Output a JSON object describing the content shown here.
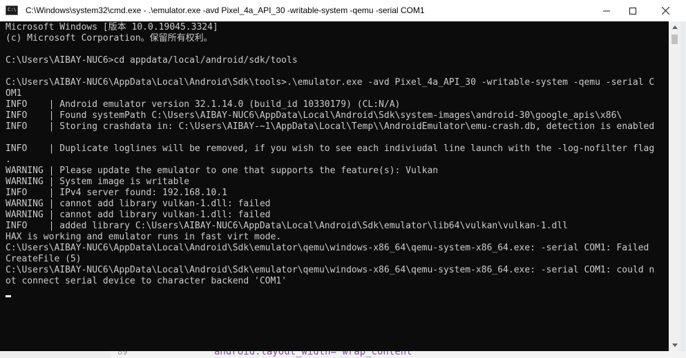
{
  "window": {
    "title": "C:\\Windows\\system32\\cmd.exe - .\\emulator.exe  -avd Pixel_4a_API_30 -writable-system -qemu -serial COM1",
    "icon_label": "C:\\"
  },
  "console": {
    "text": "Microsoft Windows [版本 10.0.19045.3324]\n(c) Microsoft Corporation。保留所有权利。\n\nC:\\Users\\AIBAY-NUC6>cd appdata/local/android/sdk/tools\n\nC:\\Users\\AIBAY-NUC6\\AppData\\Local\\Android\\Sdk\\tools>.\\emulator.exe -avd Pixel_4a_API_30 -writable-system -qemu -serial C\nOM1\nINFO    | Android emulator version 32.1.14.0 (build_id 10330179) (CL:N/A)\nINFO    | Found systemPath C:\\Users\\AIBAY-NUC6\\AppData\\Local\\Android\\Sdk\\system-images\\android-30\\google_apis\\x86\\\nINFO    | Storing crashdata in: C:\\Users\\AIBAY-~1\\AppData\\Local\\Temp\\\\AndroidEmulator\\emu-crash.db, detection is enabled\n\nINFO    | Duplicate loglines will be removed, if you wish to see each indiviudal line launch with the -log-nofilter flag\n.\nWARNING | Please update the emulator to one that supports the feature(s): Vulkan\nWARNING | System image is writable\nINFO    | IPv4 server found: 192.168.10.1\nWARNING | cannot add library vulkan-1.dll: failed\nWARNING | cannot add library vulkan-1.dll: failed\nINFO    | added library C:\\Users\\AIBAY-NUC6\\AppData\\Local\\Android\\Sdk\\emulator\\lib64\\vulkan\\vulkan-1.dll\nHAX is working and emulator runs in fast virt mode.\nC:\\Users\\AIBAY-NUC6\\AppData\\Local\\Android\\Sdk\\emulator\\qemu\\windows-x86_64\\qemu-system-x86_64.exe: -serial COM1: Failed\nCreateFile (5)\nC:\\Users\\AIBAY-NUC6\\AppData\\Local\\Android\\Sdk\\emulator\\qemu\\windows-x86_64\\qemu-system-x86_64.exe: -serial COM1: could n\not connect serial device to character backend 'COM1'"
  },
  "background_editor": {
    "line_number": "89",
    "code": "android:layout_width=\"wrap_content\""
  },
  "icons": {
    "minimize": "minimize-icon",
    "maximize": "maximize-icon",
    "close": "close-icon",
    "scroll_up": "scroll-up-arrow-icon",
    "scroll_down": "scroll-down-arrow-icon"
  },
  "colors": {
    "console_background": "#0c0c0c",
    "console_text": "#cccccc",
    "titlebar_background": "#ffffff"
  }
}
